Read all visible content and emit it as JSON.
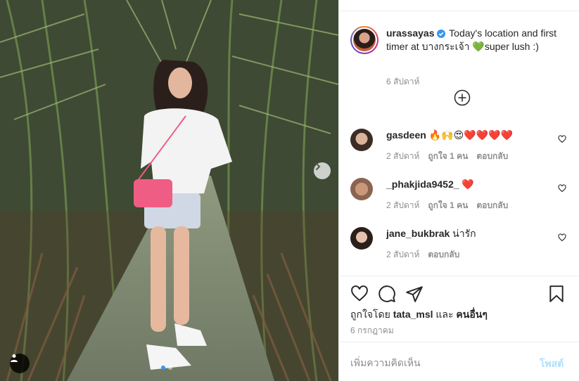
{
  "post": {
    "caption": {
      "username": "urassayas",
      "verified": true,
      "text": "Today's location and first timer at บางกระเจ้า 💚super lush :)",
      "time": "6 สัปดาห์"
    },
    "comments": [
      {
        "username": "gasdeen",
        "text": "🔥🙌😍❤️❤️❤️❤️",
        "time": "2 สัปดาห์",
        "likes": "ถูกใจ 1 คน",
        "reply": "ตอบกลับ",
        "avatar_color": "#6b5a4a"
      },
      {
        "username": "_phakjida9452_",
        "text": "❤️",
        "time": "2 สัปดาห์",
        "likes": "ถูกใจ 1 คน",
        "reply": "ตอบกลับ",
        "avatar_color": "#b9886c"
      },
      {
        "username": "jane_bukbrak",
        "text": "น่ารัก",
        "time": "2 สัปดาห์",
        "likes": "",
        "reply": "ตอบกลับ",
        "avatar_color": "#3a2a26"
      }
    ],
    "liked_by_prefix": "ถูกใจโดย",
    "liked_by_user": "tata_msl",
    "liked_by_and": "และ",
    "liked_by_others": "คนอื่นๆ",
    "date": "6 กรกฎาคม",
    "comment_placeholder": "เพิ่มความคิดเห็น",
    "post_label": "โพสต์"
  },
  "carousel": {
    "slides": 2,
    "current": 1
  },
  "colors": {
    "accent": "#3897f0",
    "post_disabled": "#b2dffc",
    "secondary_text": "#8e8e8e"
  },
  "icons": [
    "heart-icon",
    "comment-icon",
    "share-icon",
    "bookmark-icon",
    "plus-circle-icon",
    "chevron-right-icon",
    "user-tag-icon",
    "verified-badge-icon"
  ]
}
